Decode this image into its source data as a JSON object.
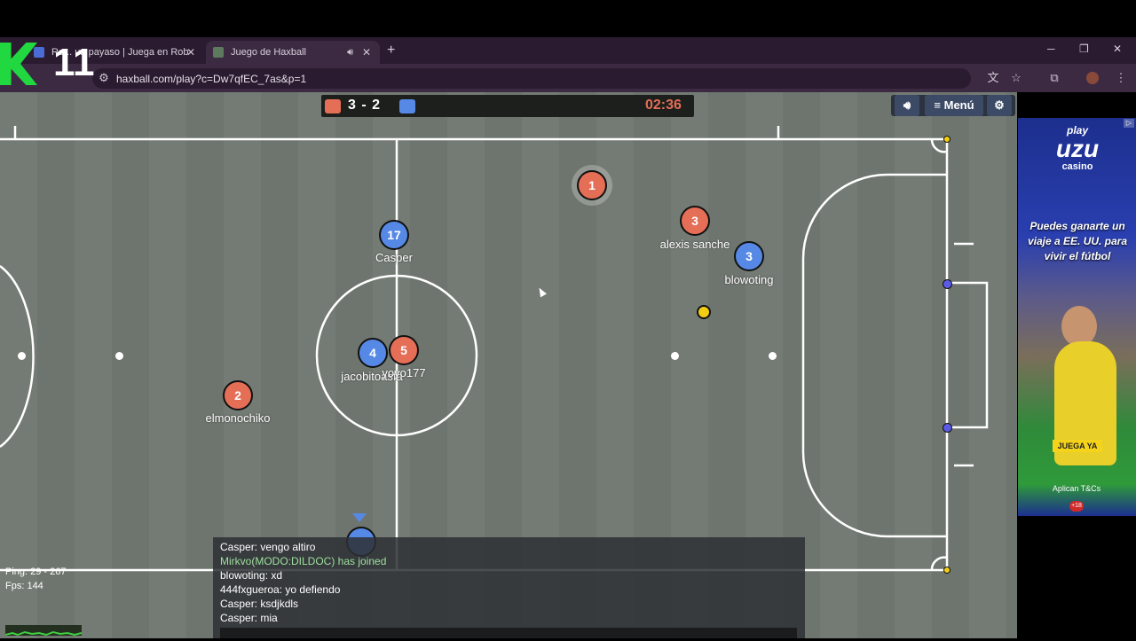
{
  "browser": {
    "tabs": [
      {
        "title": "Ro... un payaso | Juega en Rob"
      },
      {
        "title": "Juego de Haxball"
      }
    ],
    "url": "haxball.com/play?c=Dw7qfEC_7as&p=1",
    "overlay_logo_text": "11"
  },
  "scoreboard": {
    "score": "3 - 2",
    "timer": "02:36",
    "red_color": "#e56e56",
    "blue_color": "#5689e5"
  },
  "menu": {
    "sound_icon": "speaker-icon",
    "menu_label": "≡ Menú",
    "settings_icon": "gear-icon"
  },
  "players": [
    {
      "number": "1",
      "team": "red",
      "name": ""
    },
    {
      "number": "3",
      "team": "red",
      "name": "alexis sanche"
    },
    {
      "number": "3",
      "team": "blue",
      "name": "blowoting"
    },
    {
      "number": "17",
      "team": "blue",
      "name": "Casper"
    },
    {
      "number": "4",
      "team": "blue",
      "name": "jacobitoasfa"
    },
    {
      "number": "5",
      "team": "red",
      "name": "yoyo177"
    },
    {
      "number": "2",
      "team": "red",
      "name": "elmonochiko"
    }
  ],
  "chat": {
    "messages": [
      {
        "text": "Casper: vengo altiro",
        "type": "normal"
      },
      {
        "text": "Mirkvo(MODO:DILDOC) has joined",
        "type": "join"
      },
      {
        "text": "blowoting: xd",
        "type": "normal"
      },
      {
        "text": "444fxgueroa: yo defiendo",
        "type": "normal"
      },
      {
        "text": "Casper: ksdjkdls",
        "type": "normal"
      },
      {
        "text": "Casper: mia",
        "type": "normal"
      }
    ]
  },
  "stats": {
    "ping": "Ping: 29 - 267",
    "fps": "Fps: 144"
  },
  "ad": {
    "brand_top": "play",
    "brand_main": "uzu",
    "brand_sub": "casino",
    "headline": "Puedes ganarte un viaje a EE. UU. para vivir el fútbol",
    "cta": "JUEGA YA",
    "terms": "Aplican T&Cs",
    "age": "+18"
  }
}
